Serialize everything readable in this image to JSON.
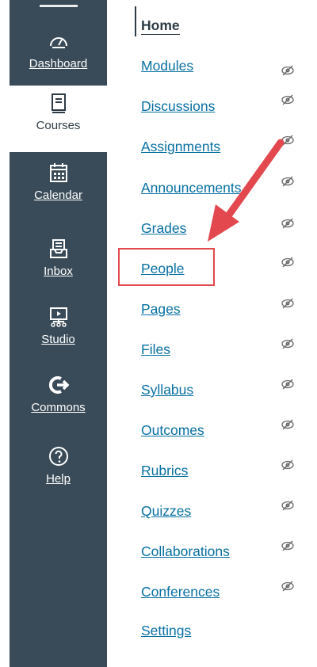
{
  "global_nav": {
    "items": [
      {
        "label": "Dashboard",
        "icon": "dashboard-icon"
      },
      {
        "label": "Courses",
        "icon": "book-icon",
        "active": true
      },
      {
        "label": "Calendar",
        "icon": "calendar-icon"
      },
      {
        "label": "Inbox",
        "icon": "inbox-icon"
      },
      {
        "label": "Studio",
        "icon": "studio-icon"
      },
      {
        "label": "Commons",
        "icon": "commons-icon"
      },
      {
        "label": "Help",
        "icon": "help-icon"
      }
    ]
  },
  "course_nav": {
    "items": [
      {
        "label": "Home",
        "current": true,
        "hidden_icon": false
      },
      {
        "label": "Modules",
        "hidden_icon": true
      },
      {
        "label": "Discussions",
        "hidden_icon": true
      },
      {
        "label": "Assignments",
        "hidden_icon": true
      },
      {
        "label": "Announcements",
        "hidden_icon": true
      },
      {
        "label": "Grades",
        "hidden_icon": true
      },
      {
        "label": "People",
        "hidden_icon": true,
        "highlighted": true
      },
      {
        "label": "Pages",
        "hidden_icon": true
      },
      {
        "label": "Files",
        "hidden_icon": true
      },
      {
        "label": "Syllabus",
        "hidden_icon": true
      },
      {
        "label": "Outcomes",
        "hidden_icon": true
      },
      {
        "label": "Rubrics",
        "hidden_icon": true
      },
      {
        "label": "Quizzes",
        "hidden_icon": true
      },
      {
        "label": "Collaborations",
        "hidden_icon": true
      },
      {
        "label": "Conferences",
        "hidden_icon": true
      },
      {
        "label": "Settings",
        "hidden_icon": false
      }
    ]
  },
  "colors": {
    "nav_bg": "#394b58",
    "link": "#0770a3",
    "annotation": "#e2484d"
  }
}
